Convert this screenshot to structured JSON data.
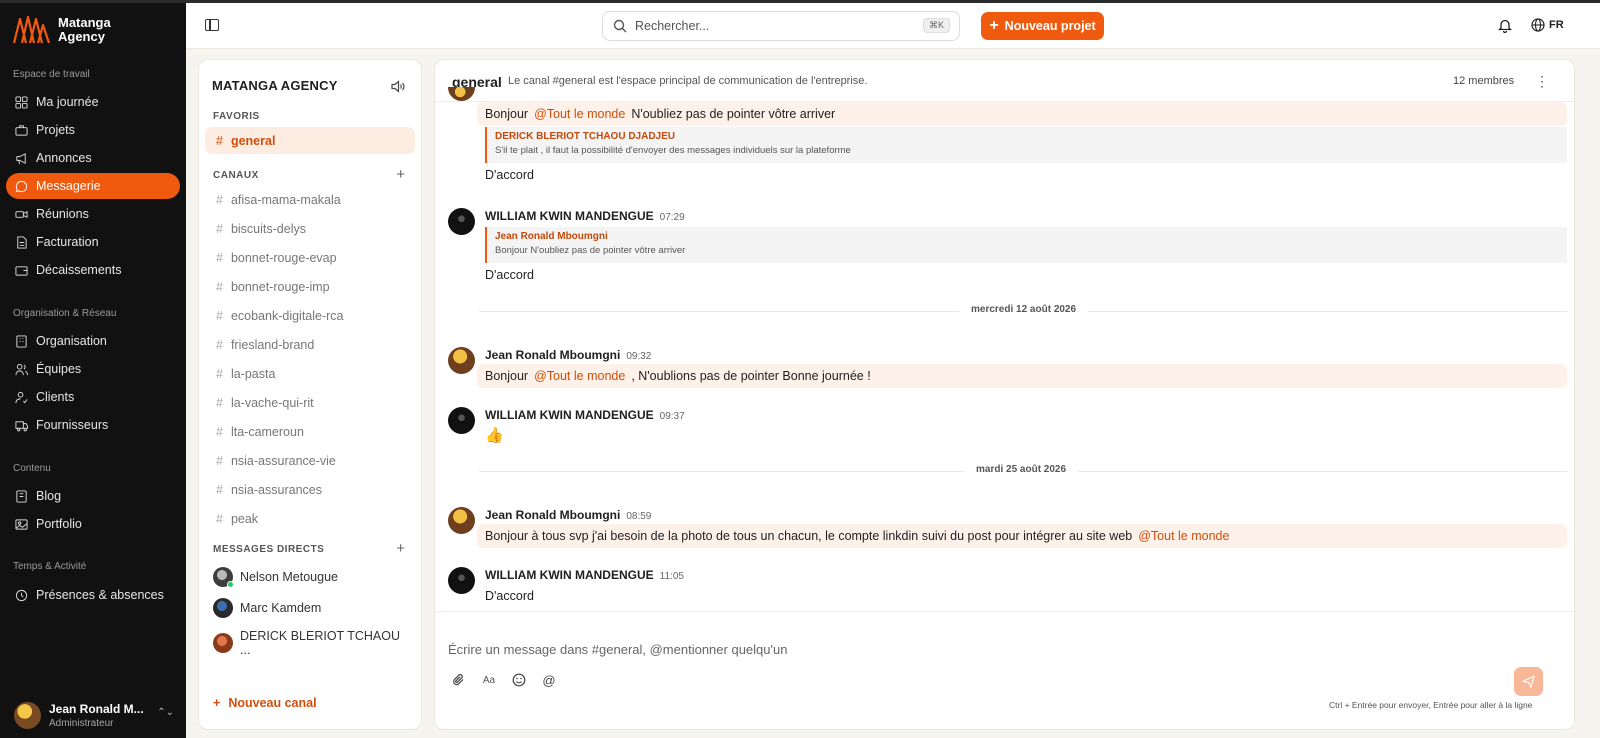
{
  "brand": {
    "line1": "Matanga",
    "line2": "Agency"
  },
  "sidebar": {
    "sections": [
      {
        "title": "Espace de travail",
        "items": [
          {
            "label": "Ma journée",
            "icon": "grid-icon"
          },
          {
            "label": "Projets",
            "icon": "briefcase-icon"
          },
          {
            "label": "Annonces",
            "icon": "megaphone-icon"
          },
          {
            "label": "Messagerie",
            "icon": "chat-icon",
            "active": true
          },
          {
            "label": "Réunions",
            "icon": "video-icon"
          },
          {
            "label": "Facturation",
            "icon": "document-icon"
          },
          {
            "label": "Décaissements",
            "icon": "wallet-icon"
          }
        ]
      },
      {
        "title": "Organisation & Réseau",
        "items": [
          {
            "label": "Organisation",
            "icon": "building-icon"
          },
          {
            "label": "Équipes",
            "icon": "users-icon"
          },
          {
            "label": "Clients",
            "icon": "client-icon"
          },
          {
            "label": "Fournisseurs",
            "icon": "truck-icon"
          }
        ]
      },
      {
        "title": "Contenu",
        "items": [
          {
            "label": "Blog",
            "icon": "book-icon"
          },
          {
            "label": "Portfolio",
            "icon": "image-icon"
          }
        ]
      },
      {
        "title": "Temps & Activité",
        "items": [
          {
            "label": "Présences & absences",
            "icon": "clock-icon"
          }
        ]
      }
    ],
    "user": {
      "name": "Jean Ronald M...",
      "role": "Administrateur"
    }
  },
  "topbar": {
    "search_placeholder": "Rechercher...",
    "search_shortcut": "⌘K",
    "new_project": "Nouveau projet",
    "lang": "FR"
  },
  "channels": {
    "workspace": "MATANGA AGENCY",
    "favorites_title": "FAVORIS",
    "favorites": [
      "general"
    ],
    "channels_title": "CANAUX",
    "list": [
      "afisa-mama-makala",
      "biscuits-delys",
      "bonnet-rouge-evap",
      "bonnet-rouge-imp",
      "ecobank-digitale-rca",
      "friesland-brand",
      "la-pasta",
      "la-vache-qui-rit",
      "lta-cameroun",
      "nsia-assurance-vie",
      "nsia-assurances",
      "peak"
    ],
    "dm_title": "MESSAGES DIRECTS",
    "dms": [
      "Nelson Metougue",
      "Marc Kamdem",
      "DERICK BLERIOT TCHAOU ..."
    ],
    "new_channel": "Nouveau canal"
  },
  "chat": {
    "name": "general",
    "description": "Le canal #general est l'espace principal de communication de l'entreprise.",
    "members": "12 membres",
    "messages": {
      "m0": {
        "before": "Bonjour",
        "mention": "@Tout le monde",
        "after": "N'oubliez pas de pointer vôtre arriver"
      },
      "q1": {
        "author": "DERICK BLERIOT TCHAOU DJADJEU",
        "text": "S'il te plait , il faut la possibilité d'envoyer des messages individuels sur la plateforme"
      },
      "t1": "D'accord",
      "m2": {
        "author": "WILLIAM KWIN MANDENGUE",
        "time": "07:29",
        "quote_author": "Jean Ronald Mboumgni",
        "quote_text": "Bonjour N'oubliez pas de pointer vôtre arriver",
        "text": "D'accord"
      },
      "d1": "mercredi 12 août 2026",
      "m3": {
        "author": "Jean Ronald Mboumgni",
        "time": "09:32",
        "before": "Bonjour",
        "mention": "@Tout le monde",
        "after": ", N'oublions pas de pointer Bonne journée !"
      },
      "m4": {
        "author": "WILLIAM KWIN MANDENGUE",
        "time": "09:37",
        "text": "👍"
      },
      "d2": "mardi 25 août 2026",
      "m5": {
        "author": "Jean Ronald Mboumgni",
        "time": "08:59",
        "before": "Bonjour à tous svp j'ai besoin de la photo de tous un chacun, le compte linkdin suivi du post pour intégrer au site web",
        "mention": "@Tout le monde"
      },
      "m6": {
        "author": "WILLIAM KWIN MANDENGUE",
        "time": "11:05",
        "text": "D'accord"
      }
    },
    "composer": {
      "placeholder": "Écrire un message dans #general, @mentionner quelqu'un",
      "format_label": "Aa",
      "hint": "Ctrl + Entrée pour envoyer, Entrée pour aller à la ligne"
    }
  },
  "colors": {
    "accent": "#f05a0f",
    "sidebar_bg": "#111111",
    "mention_bg": "#fef1ea"
  }
}
